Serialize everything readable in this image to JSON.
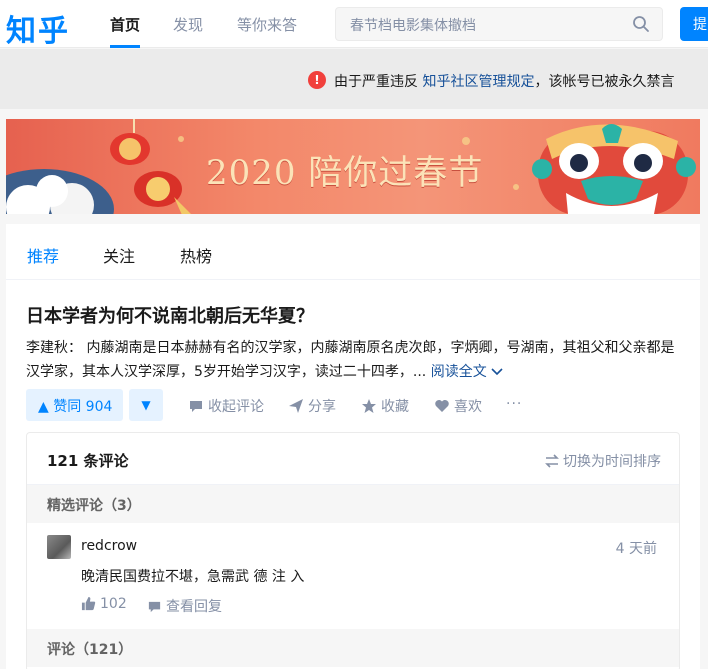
{
  "header": {
    "logo": "知乎",
    "nav": [
      "首页",
      "发现",
      "等你来答"
    ],
    "search_placeholder": "春节档电影集体撤档",
    "ask_label": "提"
  },
  "notice": {
    "prefix": "由于严重违反",
    "link": "知乎社区管理规定",
    "suffix": "，该帐号已被永久禁言"
  },
  "banner": {
    "title": "2020 陪你过春节"
  },
  "tabs": [
    "推荐",
    "关注",
    "热榜"
  ],
  "question": {
    "title": "日本学者为何不说南北朝后无华夏？",
    "author": "李建秋：",
    "excerpt": "内藤湖南是日本赫赫有名的汉学家，内藤湖南原名虎次郎，字炳卿，号湖南，其祖父和父亲都是汉学家，其本人汉学深厚，5岁开始学习汉字，读过二十四孝，...",
    "read_more": "阅读全文"
  },
  "actions": {
    "upvote": "▲ 赞同 904",
    "downvote": "▼",
    "collapse_comments": "收起评论",
    "share": "分享",
    "favorite": "收藏",
    "like": "喜欢",
    "more": "···"
  },
  "comments": {
    "count_label": "121 条评论",
    "sort_label": "切换为时间排序",
    "featured_label": "精选评论（3）",
    "all_label": "评论（121）",
    "items": [
      {
        "user": "redcrow",
        "time": "4 天前",
        "text": "晚清民国费拉不堪，急需武 德 注 入",
        "likes": "102",
        "reply_label": "查看回复"
      }
    ]
  },
  "colors": {
    "brand": "#0084ff",
    "link": "#175199",
    "muted": "#8590a6",
    "alert": "#f1403c"
  }
}
